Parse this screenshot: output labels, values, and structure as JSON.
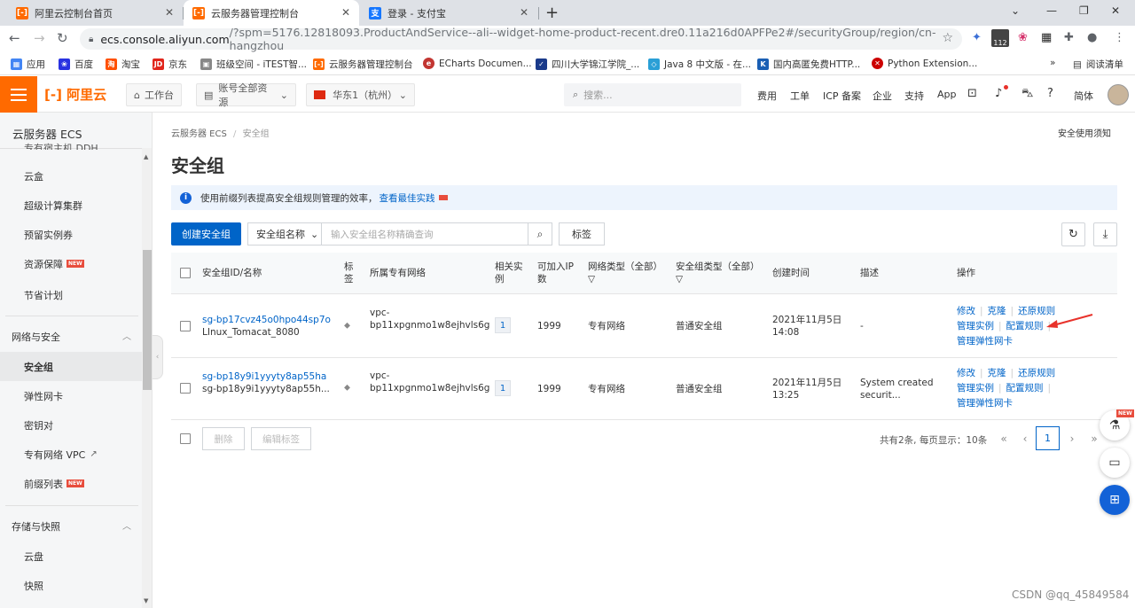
{
  "browser": {
    "tabs": [
      {
        "title": "阿里云控制台首页",
        "active": false
      },
      {
        "title": "云服务器管理控制台",
        "active": true
      },
      {
        "title": "登录 - 支付宝",
        "active": false
      }
    ],
    "url_host": "ecs.console.aliyun.com",
    "url_rest": "/?spm=5176.12818093.ProductAndService--ali--widget-home-product-recent.dre0.11a216d0APFPe2#/securityGroup/region/cn-hangzhou",
    "ext_badge": "112",
    "bookmarks": [
      "应用",
      "百度",
      "淘宝",
      "京东",
      "班级空间 - iTEST智...",
      "云服务器管理控制台",
      "ECharts Documen...",
      "四川大学锦江学院_...",
      "Java 8 中文版 - 在...",
      "国内高匿免费HTTP...",
      "Python Extension..."
    ],
    "reading_list": "阅读清单"
  },
  "header": {
    "logo": "阿里云",
    "workbench": "工作台",
    "account_resources": "账号全部资源",
    "region": "华东1（杭州）",
    "search_placeholder": "搜索...",
    "links": [
      "费用",
      "工单",
      "ICP 备案",
      "企业",
      "支持",
      "App"
    ],
    "language": "简体"
  },
  "sidebar": {
    "title": "云服务器 ECS",
    "partial_item": "专有宿主机 DDH",
    "items_top": [
      "云盒",
      "超级计算集群",
      "预留实例券",
      "资源保障",
      "节省计划"
    ],
    "new_label": "NEW",
    "group_network": "网络与安全",
    "network_items": [
      "安全组",
      "弹性网卡",
      "密钥对",
      "专有网络 VPC",
      "前缀列表"
    ],
    "group_storage": "存储与快照",
    "storage_items": [
      "云盘",
      "快照"
    ]
  },
  "main": {
    "breadcrumb_root": "云服务器 ECS",
    "breadcrumb_sep": "/",
    "breadcrumb_current": "安全组",
    "notice_link": "安全使用须知",
    "title": "安全组",
    "info_text": "使用前缀列表提高安全组规则管理的效率，",
    "info_link": "查看最佳实践",
    "create_button": "创建安全组",
    "filter_field": "安全组名称",
    "filter_placeholder": "输入安全组名称精确查询",
    "tag_button": "标签"
  },
  "table": {
    "headers": {
      "id_name": "安全组ID/名称",
      "tag": "标签",
      "vpc": "所属专有网络",
      "instances": "相关实例",
      "joinable_ip": "可加入IP数",
      "network_type": "网络类型（全部）",
      "group_type": "安全组类型（全部）",
      "created": "创建时间",
      "desc": "描述",
      "ops": "操作"
    },
    "rows": [
      {
        "id": "sg-bp17cvz45o0hpo44sp7o",
        "name": "LInux_Tomacat_8080",
        "vpc_line1": "vpc-",
        "vpc_line2": "bp11xpgnmo1w8ejhvls6g",
        "instances": "1",
        "joinable_ip": "1999",
        "network_type": "专有网络",
        "group_type": "普通安全组",
        "created_date": "2021年11月5日",
        "created_time": "14:08",
        "desc": "-",
        "op_edit": "修改",
        "op_clone": "克隆",
        "op_restore": "还原规则",
        "op_instances": "管理实例",
        "op_rules": "配置规则",
        "op_eni": "管理弹性网卡"
      },
      {
        "id": "sg-bp18y9i1yyyty8ap55ha",
        "name": "sg-bp18y9i1yyyty8ap55h...",
        "vpc_line1": "vpc-",
        "vpc_line2": "bp11xpgnmo1w8ejhvls6g",
        "instances": "1",
        "joinable_ip": "1999",
        "network_type": "专有网络",
        "group_type": "普通安全组",
        "created_date": "2021年11月5日",
        "created_time": "13:25",
        "desc_line1": "System created",
        "desc_line2": "securit...",
        "op_edit": "修改",
        "op_clone": "克隆",
        "op_restore": "还原规则",
        "op_instances": "管理实例",
        "op_rules": "配置规则",
        "op_eni": "管理弹性网卡"
      }
    ]
  },
  "footer": {
    "delete_button": "删除",
    "edit_tags_button": "编辑标签",
    "page_info": "共有2条, 每页显示：10条",
    "current_page": "1"
  },
  "floating": {
    "new_label": "NEW"
  },
  "watermark": "CSDN @qq_45849584",
  "colors": {
    "brand": "#ff6a00",
    "link": "#0064c8",
    "primary_button": "#0064c8",
    "arrow": "#e8322b"
  }
}
